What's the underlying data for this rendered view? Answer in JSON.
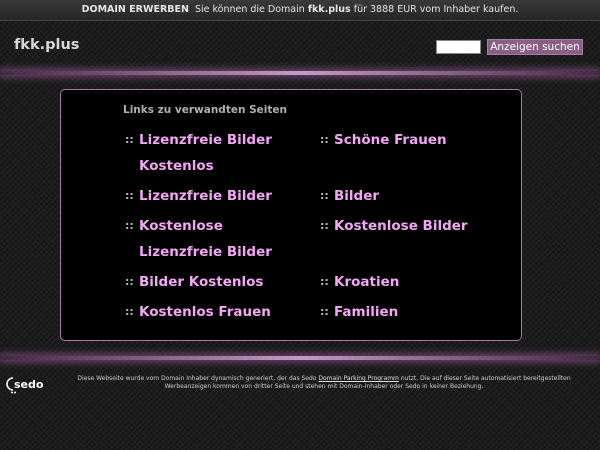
{
  "topbar": {
    "buy_label": "DOMAIN ERWERBEN",
    "text_before": "Sie können die Domain",
    "domain": "fkk.plus",
    "text_after": "für 3888 EUR vom Inhaber kaufen."
  },
  "header": {
    "site_title": "fkk.plus",
    "search_value": "",
    "search_button": "Anzeigen suchen"
  },
  "main": {
    "heading": "Links zu verwandten Seiten",
    "left_links": [
      {
        "line1": "Lizenzfreie Bilder",
        "line2": "Kostenlos"
      },
      {
        "line1": "Lizenzfreie Bilder",
        "line2": ""
      },
      {
        "line1": "Kostenlose",
        "line2": "Lizenzfreie Bilder"
      },
      {
        "line1": "Bilder Kostenlos",
        "line2": ""
      },
      {
        "line1": "Kostenlos Frauen",
        "line2": ""
      }
    ],
    "right_links": [
      {
        "line1": "Schöne Frauen"
      },
      {
        "line1": "Bilder"
      },
      {
        "line1": "Kostenlose Bilder"
      },
      {
        "line1": "Kroatien"
      },
      {
        "line1": "Familien"
      }
    ],
    "bullet": "::"
  },
  "footer": {
    "logo_text": "sedo",
    "text_1": "Diese Webseite wurde vom Domain Inhaber dynamisch generiert, der das Sedo",
    "link": "Domain Parking Programm",
    "text_2": "nutzt. Die auf dieser Seite automatisiert bereitgestellten Werbeanzeigen kommen von dritter Seite und stehen mit Domain-Inhaber oder Sedo in keiner Beziehung."
  },
  "colors": {
    "accent": "#f3a6f3",
    "button": "#8a5f86",
    "glow": "#c49ac4"
  }
}
